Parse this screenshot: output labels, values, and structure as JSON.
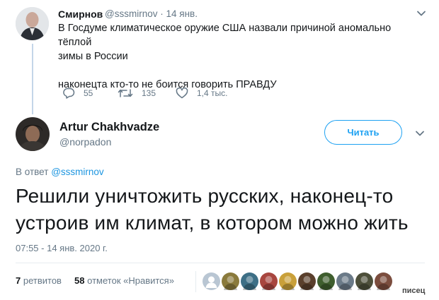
{
  "tweet1": {
    "author_name": "Смирнов",
    "author_handle": "@sssmirnov",
    "separator": "·",
    "date": "14 янв.",
    "line1": "В Госдуме климатическое оружие США назвали причиной аномально тёплой",
    "line2": "зимы в России",
    "line3": "наконецта кто-то не боится говорить ПРАВДУ",
    "replies": "55",
    "retweets": "135",
    "likes": "1,4 тыс."
  },
  "tweet2": {
    "author_name": "Artur Chakhvadze",
    "author_handle": "@norpadon",
    "follow_label": "Читать",
    "reply_prefix": "В ответ",
    "reply_handle": "@sssmirnov",
    "text_line1": "Решили уничтожить русских, наконец-то",
    "text_line2": "устроив им климат, в котором можно жить",
    "timestamp": "07:55 - 14 янв. 2020 г.",
    "retweets_count": "7",
    "retweets_label": "ретвитов",
    "likes_count": "58",
    "likes_label": "отметок «Нравится»"
  },
  "watermark": "писец",
  "colors": {
    "accent": "#1da1f2",
    "link": "#1b95e0",
    "muted": "#657786",
    "thread_line": "#c4d6e8"
  },
  "likers": [
    {
      "icon": "default-avatar-icon",
      "color": "#b9c6d3"
    },
    {
      "icon": "avatar-photo",
      "color": "#8a7a3c"
    },
    {
      "icon": "avatar-photo",
      "color": "#3d6f86"
    },
    {
      "icon": "avatar-photo",
      "color": "#a8463f"
    },
    {
      "icon": "avatar-photo",
      "color": "#c9a03a"
    },
    {
      "icon": "avatar-photo",
      "color": "#5a3f2c"
    },
    {
      "icon": "avatar-photo",
      "color": "#3f5e2e"
    },
    {
      "icon": "avatar-photo",
      "color": "#6b7a88"
    },
    {
      "icon": "avatar-photo",
      "color": "#4d4f3a"
    },
    {
      "icon": "avatar-photo",
      "color": "#7b4d3e"
    }
  ]
}
